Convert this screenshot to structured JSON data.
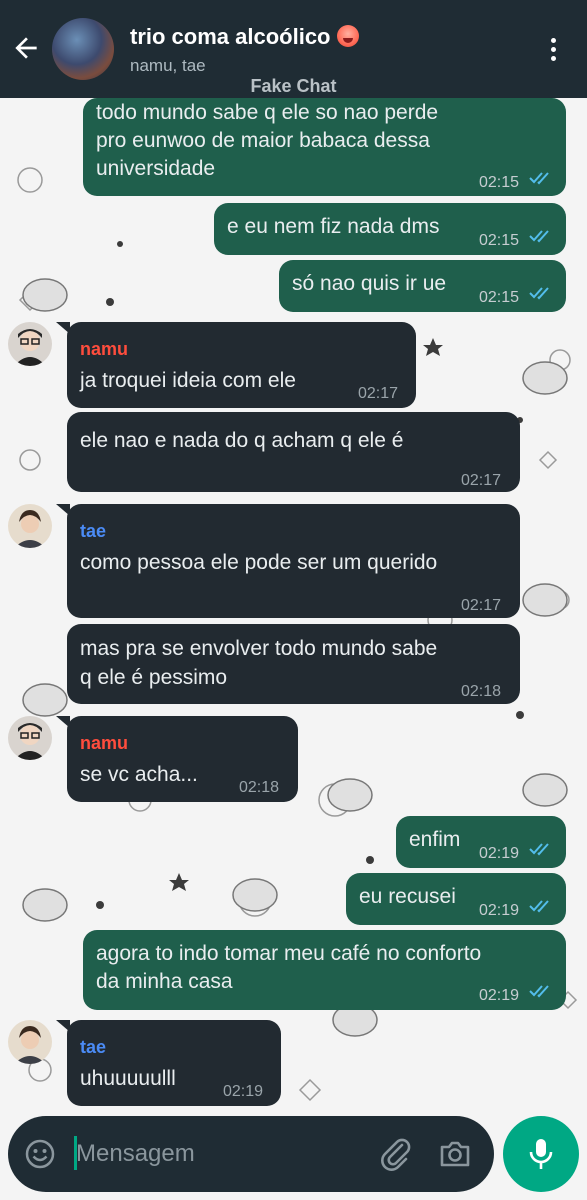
{
  "header": {
    "title": "trio coma alcoólico",
    "subtitle": "namu, tae",
    "watermark": "Fake Chat"
  },
  "messages": [
    {
      "lines": [
        "todo mundo sabe q ele so nao perde",
        "pro eunwoo de maior babaca dessa",
        "universidade"
      ],
      "time": "02:15",
      "direction": "out"
    },
    {
      "lines": [
        "e eu nem fiz nada dms"
      ],
      "time": "02:15",
      "direction": "out"
    },
    {
      "lines": [
        "só nao quis ir ue"
      ],
      "time": "02:15",
      "direction": "out"
    },
    {
      "sender": "namu",
      "lines": [
        "ja troquei ideia com ele"
      ],
      "time": "02:17",
      "direction": "in"
    },
    {
      "lines": [
        "ele nao e nada do q acham q ele é"
      ],
      "time": "02:17",
      "direction": "in"
    },
    {
      "sender": "tae",
      "lines": [
        "como pessoa ele pode ser um querido"
      ],
      "time": "02:17",
      "direction": "in"
    },
    {
      "lines": [
        "mas pra se envolver todo mundo sabe",
        "q ele é pessimo"
      ],
      "time": "02:18",
      "direction": "in"
    },
    {
      "sender": "namu",
      "lines": [
        "se vc acha..."
      ],
      "time": "02:18",
      "direction": "in"
    },
    {
      "lines": [
        "enfim"
      ],
      "time": "02:19",
      "direction": "out"
    },
    {
      "lines": [
        "eu recusei"
      ],
      "time": "02:19",
      "direction": "out"
    },
    {
      "lines": [
        "agora to indo tomar meu café no conforto",
        "da minha casa"
      ],
      "time": "02:19",
      "direction": "out"
    },
    {
      "sender": "tae",
      "lines": [
        "uhuuuuulll"
      ],
      "time": "02:19",
      "direction": "in"
    }
  ],
  "composer": {
    "placeholder": "Mensagem"
  },
  "colors": {
    "header_bg": "#1f2c34",
    "outgoing_bubble": "#1f5f4c",
    "incoming_bubble": "#222a31",
    "accent": "#00a884",
    "read_ticks": "#53bdeb",
    "namu_name": "#ff4d3d",
    "tae_name": "#4b8bf5"
  },
  "icons": [
    "back-arrow-icon",
    "more-options-icon",
    "emoji-icon",
    "attach-icon",
    "camera-icon",
    "mic-icon",
    "double-check-icon"
  ]
}
